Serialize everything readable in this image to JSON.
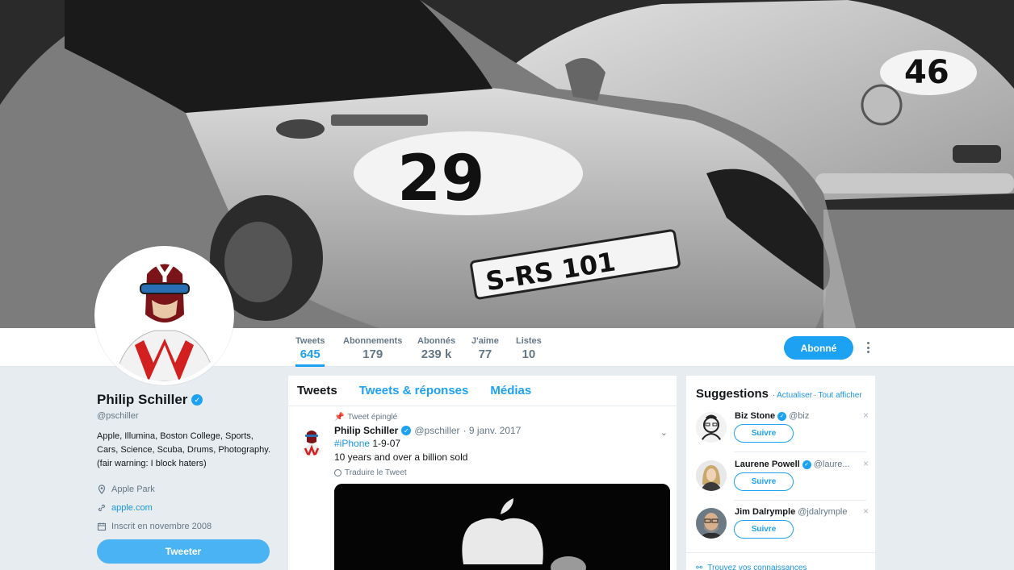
{
  "profile_nav": {
    "stats": [
      {
        "label": "Tweets",
        "value": "645"
      },
      {
        "label": "Abonnements",
        "value": "179"
      },
      {
        "label": "Abonnés",
        "value": "239 k"
      },
      {
        "label": "J'aime",
        "value": "77"
      },
      {
        "label": "Listes",
        "value": "10"
      }
    ],
    "follow_label": "Abonné"
  },
  "banner": {
    "plate_front": "S-RS 101",
    "number_front": "29",
    "number_back": "46"
  },
  "profile": {
    "name": "Philip Schiller",
    "handle": "@pschiller",
    "bio": "Apple, Illumina, Boston College, Sports, Cars, Science, Scuba, Drums, Photography. (fair warning: I block haters)",
    "location": "Apple Park",
    "website": "apple.com",
    "joined": "Inscrit en novembre 2008",
    "tweet_button": "Tweeter"
  },
  "timeline": {
    "tabs": [
      "Tweets",
      "Tweets & réponses",
      "Médias"
    ],
    "pinned_label": "Tweet épinglé",
    "tweet": {
      "name": "Philip Schiller",
      "handle": "@pschiller",
      "date": "· 9 janv. 2017",
      "hashtag": "#iPhone",
      "line1_rest": " 1-9-07",
      "line2": "10 years and over a billion sold",
      "translate": "Traduire le Tweet"
    }
  },
  "suggestions": {
    "title": "Suggestions",
    "refresh": "Actualiser",
    "view_all": "Tout afficher",
    "follow_label": "Suivre",
    "items": [
      {
        "name": "Biz Stone",
        "handle": "@biz"
      },
      {
        "name": "Laurene Powell",
        "handle": "@laure..."
      },
      {
        "name": "Jim Dalrymple",
        "handle": "@jdalrymple"
      }
    ],
    "find_contacts": "Trouvez vos connaissances"
  },
  "colors": {
    "accent": "#1da1f2",
    "link": "#1b95e0",
    "muted": "#657786",
    "background": "#e6ecf0"
  }
}
